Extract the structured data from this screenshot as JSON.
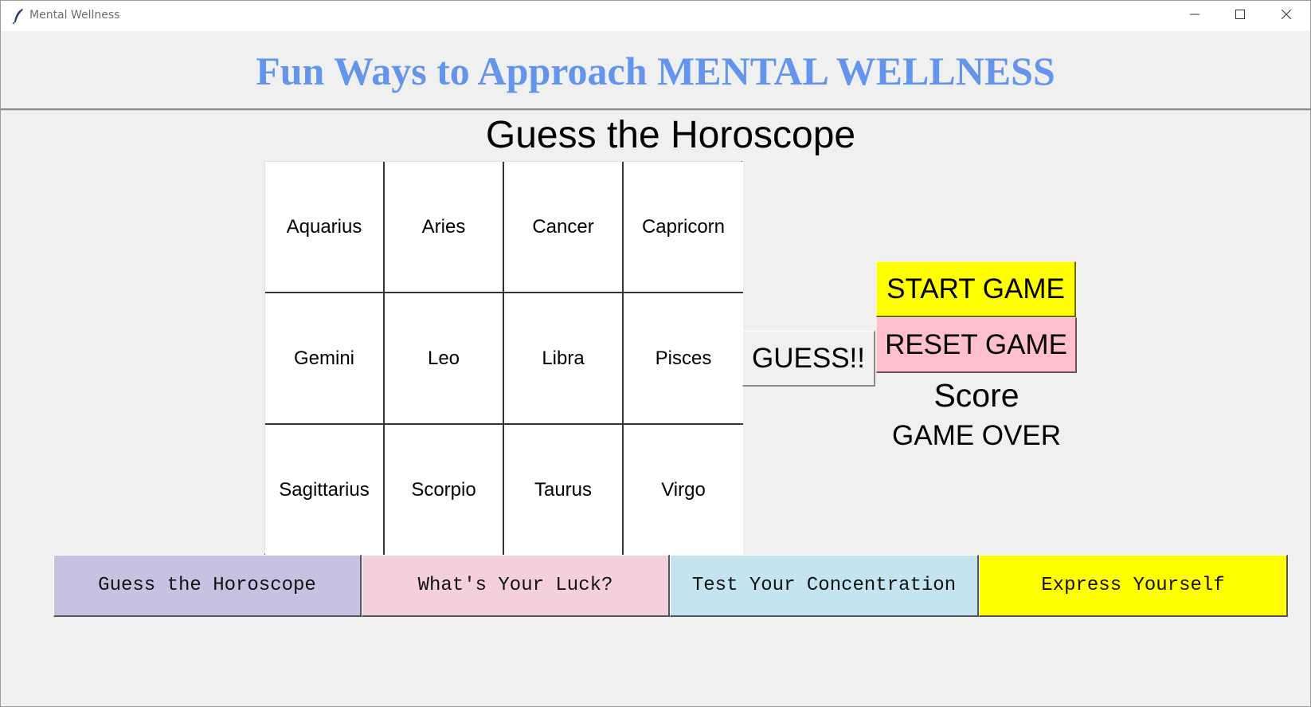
{
  "window": {
    "title": "Mental Wellness",
    "icon": "feather-icon",
    "controls": [
      "minimize-icon",
      "maximize-icon",
      "close-icon"
    ]
  },
  "header": {
    "title": "Fun Ways to Approach MENTAL WELLNESS",
    "color": "#6495ed"
  },
  "game": {
    "title": "Guess the Horoscope",
    "signs": [
      "Aquarius",
      "Aries",
      "Cancer",
      "Capricorn",
      "Gemini",
      "Leo",
      "Libra",
      "Pisces",
      "Sagittarius",
      "Scorpio",
      "Taurus",
      "Virgo"
    ],
    "guess_label": "GUESS!!",
    "start_label": "START GAME",
    "reset_label": "RESET GAME",
    "score_label": "Score",
    "score_value": "GAME OVER"
  },
  "tabs": [
    {
      "label": "Guess the Horoscope",
      "color": "#c8c1e2"
    },
    {
      "label": "What's Your Luck?",
      "color": "#f4d0de"
    },
    {
      "label": "Test Your Concentration",
      "color": "#c5e4f1"
    },
    {
      "label": "Express Yourself",
      "color": "#ffff00"
    }
  ]
}
